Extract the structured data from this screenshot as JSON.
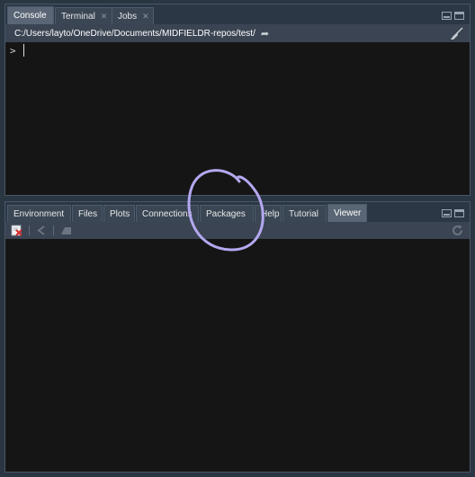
{
  "console_pane": {
    "tabs": [
      {
        "label": "Console",
        "active": true,
        "closable": false
      },
      {
        "label": "Terminal",
        "active": false,
        "closable": true
      },
      {
        "label": "Jobs",
        "active": false,
        "closable": true
      }
    ],
    "path": "C:/Users/layto/OneDrive/Documents/MIDFIELDR-repos/test/",
    "prompt": ">"
  },
  "viewer_pane": {
    "tabs": [
      {
        "label": "Environment",
        "active": false
      },
      {
        "label": "Files",
        "active": false
      },
      {
        "label": "Plots",
        "active": false
      },
      {
        "label": "Connections",
        "active": false
      },
      {
        "label": "Packages",
        "active": false
      },
      {
        "label": "Help",
        "active": false
      },
      {
        "label": "Tutorial",
        "active": false
      },
      {
        "label": "Viewer",
        "active": true
      }
    ]
  },
  "close_glyph": "✕",
  "colors": {
    "background": "#2a3642",
    "pane": "#151515",
    "tab": "#3a4654",
    "tab_active": "#5a6675",
    "annotation_circle": "#b4a8f0"
  }
}
